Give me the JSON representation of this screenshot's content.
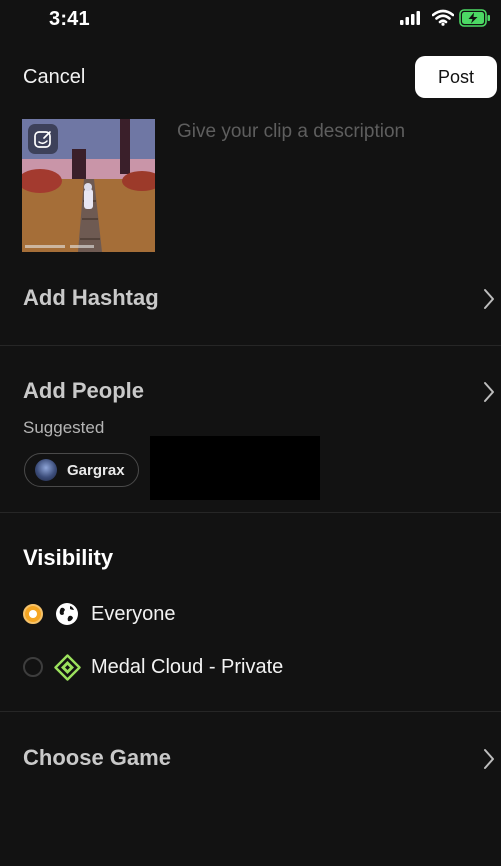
{
  "status_bar": {
    "time": "3:41",
    "icons": [
      "cellular-signal-icon",
      "wifi-icon",
      "battery-charging-icon"
    ],
    "battery_color": "#4cd964"
  },
  "header": {
    "cancel_label": "Cancel",
    "post_label": "Post"
  },
  "clip": {
    "description_placeholder": "Give your clip a description"
  },
  "sections": {
    "add_hashtag": "Add Hashtag",
    "add_people": "Add People",
    "suggested_label": "Suggested",
    "suggested_people": [
      {
        "name": "Gargrax"
      }
    ],
    "visibility": "Visibility",
    "visibility_options": [
      {
        "label": "Everyone",
        "selected": true,
        "icon": "globe-icon"
      },
      {
        "label": "Medal Cloud - Private",
        "selected": false,
        "icon": "medal-cloud-icon"
      }
    ],
    "choose_game": "Choose Game"
  },
  "colors": {
    "background": "#121212",
    "accent": "#f5a623",
    "medal_green": "#9be15d",
    "post_button": "#ffffff"
  }
}
